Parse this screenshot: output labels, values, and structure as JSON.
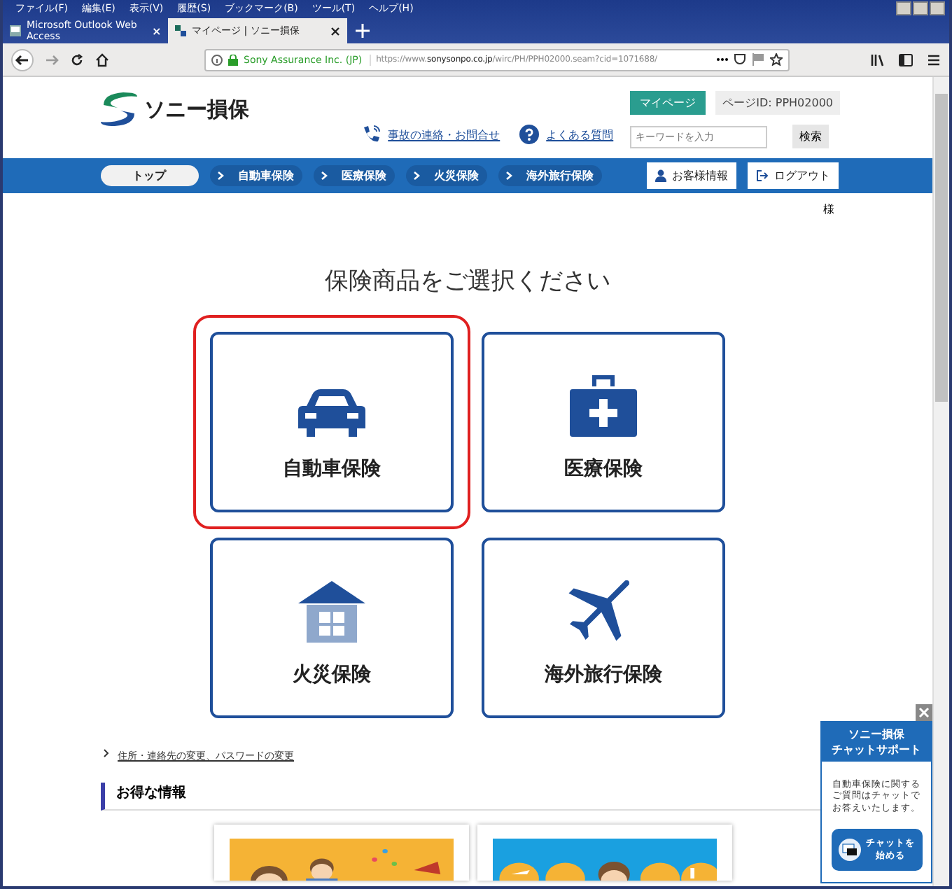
{
  "menu_bar": [
    "ファイル(F)",
    "編集(E)",
    "表示(V)",
    "履歴(S)",
    "ブックマーク(B)",
    "ツール(T)",
    "ヘルプ(H)"
  ],
  "tabs": [
    {
      "label": "Microsoft Outlook Web Access",
      "selected": false
    },
    {
      "label": "マイページ | ソニー損保",
      "selected": true
    }
  ],
  "address_bar": {
    "identity": "Sony Assurance Inc. (JP)",
    "url_prefix": "https://www.",
    "url_domain": "sonysonpo.co.jp",
    "url_path": "/wirc/PH/PPH02000.seam?cid=1071688/"
  },
  "header": {
    "logo_text": "ソニー損保",
    "mypage_button": "マイページ",
    "page_id": "ページID: PPH02000",
    "links": [
      "事故の連絡・お問合せ",
      "よくある質問"
    ],
    "search": {
      "placeholder": "キーワードを入力",
      "button": "検索"
    }
  },
  "nav": [
    {
      "label": "トップ",
      "selected": true
    },
    {
      "label": "自動車保険",
      "selected": false
    },
    {
      "label": "医療保険",
      "selected": false
    },
    {
      "label": "火災保険",
      "selected": false
    },
    {
      "label": "海外旅行保険",
      "selected": false
    }
  ],
  "account_buttons": [
    "お客様情報",
    "ログアウト"
  ],
  "customer_suffix": "様",
  "heading": "保険商品をご選択ください",
  "products": [
    {
      "label": "自動車保険",
      "kind": "car",
      "selected": true
    },
    {
      "label": "医療保険",
      "kind": "medical",
      "selected": false
    },
    {
      "label": "火災保険",
      "kind": "house",
      "selected": false
    },
    {
      "label": "海外旅行保険",
      "kind": "plane",
      "selected": false
    }
  ],
  "settings_link": "住所・連絡先の変更、パスワードの変更",
  "deals_heading": "お得な情報",
  "promos": [
    {
      "kind": "picture"
    },
    {
      "kind": "picture"
    }
  ],
  "chat": {
    "title": [
      "ソニー損保",
      "チャットサポート"
    ],
    "text": [
      "自動車保険に関する",
      "ご質問はチャットで",
      "お答えいたします。"
    ],
    "button": [
      "チャットを",
      "始める"
    ]
  }
}
